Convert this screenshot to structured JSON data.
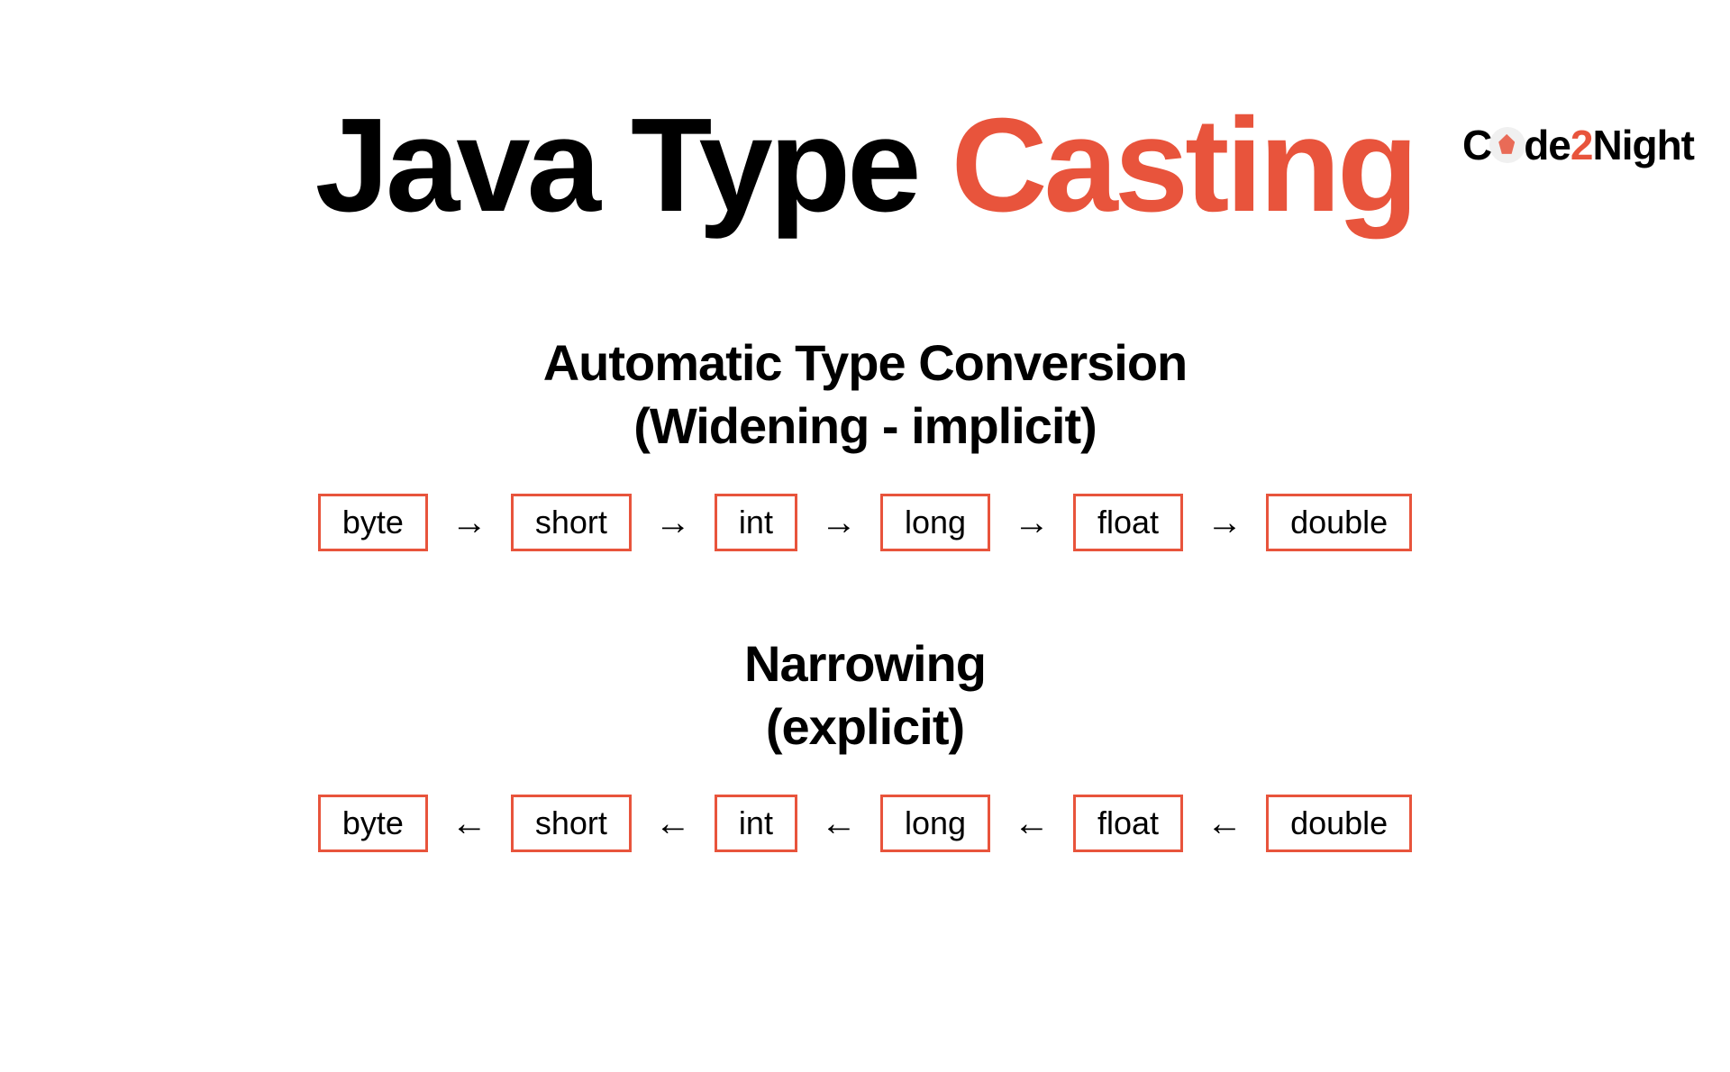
{
  "logo": {
    "part1": "C",
    "part2": "de",
    "part3": "2",
    "part4": "Night"
  },
  "title": {
    "part1": "Java Type ",
    "part2": "Casting"
  },
  "sectionA": {
    "line1": "Automatic Type Conversion",
    "line2": "(Widening - implicit)",
    "types": [
      "byte",
      "short",
      "int",
      "long",
      "float",
      "double"
    ],
    "arrow": "→"
  },
  "sectionB": {
    "line1": "Narrowing",
    "line2": "(explicit)",
    "types": [
      "byte",
      "short",
      "int",
      "long",
      "float",
      "double"
    ],
    "arrow": "←"
  },
  "colors": {
    "accent": "#e8543c",
    "black": "#000000"
  }
}
